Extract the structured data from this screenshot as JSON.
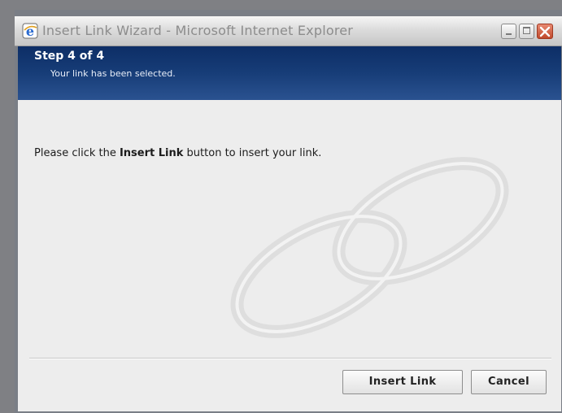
{
  "window": {
    "title": "Insert Link Wizard - Microsoft Internet Explorer",
    "icon": "ie-icon"
  },
  "banner": {
    "step": "Step 4 of 4",
    "subtitle": "Your link has been selected."
  },
  "content": {
    "instruction_before": "Please click the ",
    "instruction_bold": "Insert Link",
    "instruction_after": " button to insert your link."
  },
  "buttons": {
    "insert_label": "Insert Link",
    "cancel_label": "Cancel"
  },
  "colors": {
    "banner": "#173d78",
    "client_bg": "#ededed"
  }
}
